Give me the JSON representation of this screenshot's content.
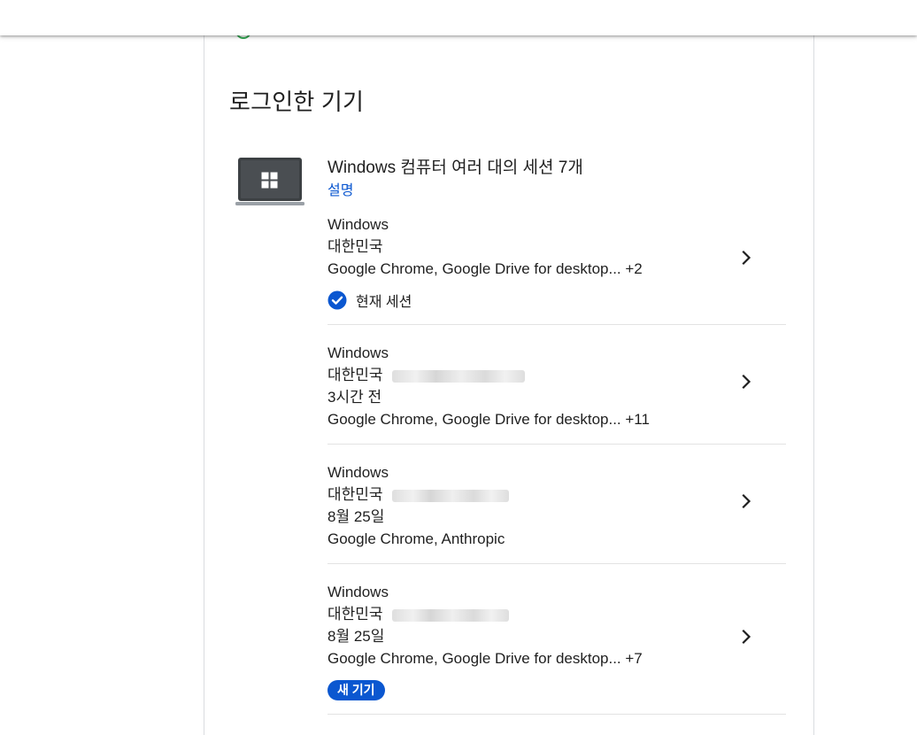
{
  "section_title": "로그인한 기기",
  "device_group": {
    "title": "Windows 컴퓨터 여러 대의 세션 7개",
    "link": "설명",
    "icon": "windows-laptop-icon"
  },
  "sessions": [
    {
      "os": "Windows",
      "location": "대한민국",
      "time": "",
      "apps": "Google Chrome, Google Drive for desktop... +2",
      "current_label": "현재 세션"
    },
    {
      "os": "Windows",
      "location": "대한민국",
      "time": "3시간 전",
      "apps": "Google Chrome, Google Drive for desktop... +11"
    },
    {
      "os": "Windows",
      "location": "대한민국",
      "time": "8월 25일",
      "apps": "Google Chrome, Anthropic"
    },
    {
      "os": "Windows",
      "location": "대한민국",
      "time": "8월 25일",
      "apps": "Google Chrome, Google Drive for desktop... +7",
      "badge": "새 기기"
    }
  ],
  "colors": {
    "accent": "#0b57d0",
    "divider": "#e3e3e3",
    "status_green": "#34a853"
  }
}
